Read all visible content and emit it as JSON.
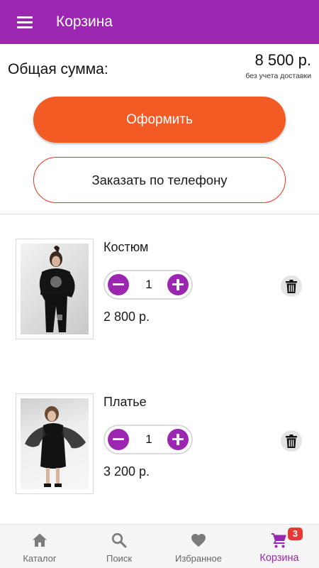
{
  "appbar": {
    "title": "Корзина",
    "menu_icon": "menu-icon"
  },
  "summary": {
    "label": "Общая сумма:",
    "total": "8 500 р.",
    "note": "без учета доставки"
  },
  "actions": {
    "checkout_label": "Оформить",
    "phone_order_label": "Заказать по телефону"
  },
  "cart_items": [
    {
      "name": "Костюм",
      "quantity": "1",
      "price": "2 800 р.",
      "image_icon": "product-photo-suit",
      "delete_icon": "trash-icon"
    },
    {
      "name": "Платье",
      "quantity": "1",
      "price": "3 200 р.",
      "image_icon": "product-photo-dress",
      "delete_icon": "trash-icon"
    }
  ],
  "bottom_nav": {
    "items": [
      {
        "label": "Каталог",
        "icon": "home-icon",
        "active": false
      },
      {
        "label": "Поиск",
        "icon": "search-icon",
        "active": false
      },
      {
        "label": "Избранное",
        "icon": "heart-icon",
        "active": false
      },
      {
        "label": "Корзина",
        "icon": "cart-icon",
        "active": true,
        "badge": "3"
      }
    ]
  },
  "colors": {
    "primary": "#9b27b0",
    "accent_orange": "#f25b24",
    "outline_red": "#e8341c",
    "badge_red": "#e53935",
    "nav_background": "#f5f5f5"
  }
}
